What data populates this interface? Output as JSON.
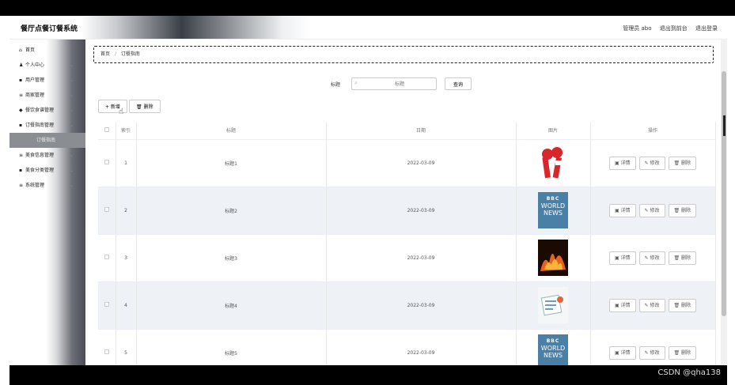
{
  "app": {
    "title": "餐厅点餐订餐系统",
    "user": "管理员 abo",
    "to_front": "退出到前台",
    "logout": "退出登录"
  },
  "sidebar": {
    "items": [
      {
        "icon": "home-icon",
        "glyph": "⌂",
        "label": "首页",
        "chevron": false
      },
      {
        "icon": "user-icon",
        "glyph": "♟",
        "label": "个人中心",
        "chevron": true
      },
      {
        "icon": "grid-icon",
        "glyph": "▪",
        "label": "用户管理",
        "chevron": true
      },
      {
        "icon": "list-icon",
        "glyph": "≡",
        "label": "商家管理",
        "chevron": true
      },
      {
        "icon": "tag-icon",
        "glyph": "◆",
        "label": "餐饮食谱管理",
        "chevron": true
      },
      {
        "icon": "grid-icon",
        "glyph": "▪",
        "label": "订餐指南管理",
        "chevron": true
      },
      {
        "icon": "",
        "glyph": "",
        "label": "订餐指南",
        "chevron": false,
        "sub": true
      },
      {
        "icon": "list-icon",
        "glyph": "≡",
        "label": "美食信息管理",
        "chevron": true
      },
      {
        "icon": "grid-icon",
        "glyph": "▪",
        "label": "美食分类管理",
        "chevron": true
      },
      {
        "icon": "list-icon",
        "glyph": "≡",
        "label": "系统管理",
        "chevron": true
      }
    ]
  },
  "breadcrumb": {
    "home": "首页",
    "sep": "/",
    "current": "订餐指南"
  },
  "search": {
    "label": "标题",
    "placeholder": "标题",
    "button": "查询"
  },
  "actions": {
    "add": "+ 新增",
    "delete": "删除"
  },
  "table": {
    "headers": [
      "",
      "索引",
      "标题",
      "日期",
      "图片",
      "操作"
    ],
    "rows": [
      {
        "index": "1",
        "title": "标题1",
        "date": "2022-03-09",
        "image": "microphones"
      },
      {
        "index": "2",
        "title": "标题2",
        "date": "2022-03-09",
        "image": "bbc-world-news"
      },
      {
        "index": "3",
        "title": "标题3",
        "date": "2022-03-09",
        "image": "fire-text"
      },
      {
        "index": "4",
        "title": "标题4",
        "date": "2022-03-09",
        "image": "newspaper"
      },
      {
        "index": "5",
        "title": "标题5",
        "date": "2022-03-09",
        "image": "bbc-world-news"
      }
    ],
    "ops": {
      "detail": "详情",
      "edit": "修改",
      "delete": "删除"
    },
    "bbc": {
      "boxes": "BBC",
      "line1": "WORLD",
      "line2": "NEWS"
    }
  },
  "watermark": "CSDN @qha138",
  "colors": {
    "row_alt": "#eef1f6",
    "bbc_blue": "#4a7fa6",
    "mic_red": "#d8262b"
  }
}
